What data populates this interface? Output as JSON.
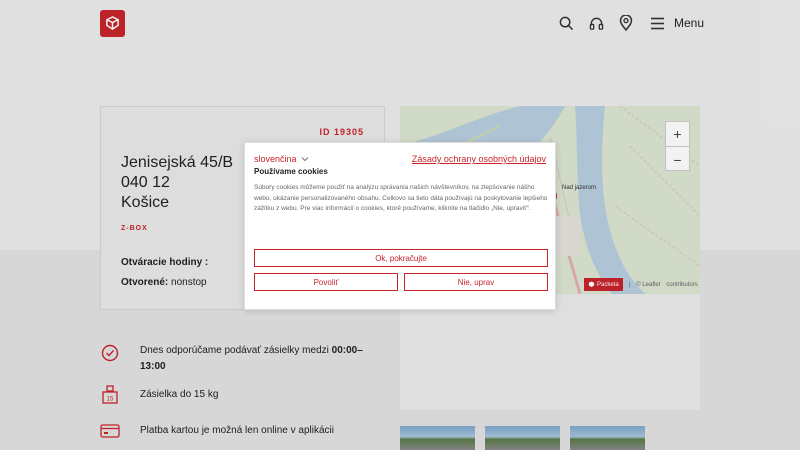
{
  "header": {
    "menu_label": "Menu"
  },
  "card": {
    "id": "ID 19305",
    "address": [
      "Jenisejská 45/B",
      "040 12",
      "Košice"
    ],
    "type": "Z-BOX",
    "hours_label": "Otváracie hodiny :",
    "open_label": "Otvorené:",
    "open_value": "nonstop"
  },
  "map": {
    "place_label": "Nad jazerom",
    "zoom_in": "+",
    "zoom_out": "−",
    "brand": "Packeta",
    "separator": "|",
    "leaflet": "© Leaflet",
    "contributors": "contributors"
  },
  "info": {
    "recommend_prefix": "Dnes odporúčame podávať zásielky medzi ",
    "recommend_time": "00:00–13:00",
    "weight": "Zásielka do 15 kg",
    "weight_badge": "15",
    "payment": "Platba kartou je možná len online v aplikácii"
  },
  "cookie": {
    "language": "slovenčina",
    "privacy_link": "Zásady ochrany osobných údajov",
    "title": "Používame cookies",
    "text": "Súbory cookies môžeme použiť na analýzu správania našich návštevníkov, na zlepšovanie nášho webu, ukázanie personalizovaného obsahu. Celkovo sa tieto dáta používajú na poskytovanie lepšieho zážitku z webu. Pre viac informácií o cookies, ktoré používame, kliknite na tlačidlo „Nie, upraviť“.",
    "ok_button": "Ok, pokračujte",
    "allow_button": "Povoliť",
    "no_button": "Nie, uprav"
  },
  "colors": {
    "brand": "#c8242b"
  }
}
